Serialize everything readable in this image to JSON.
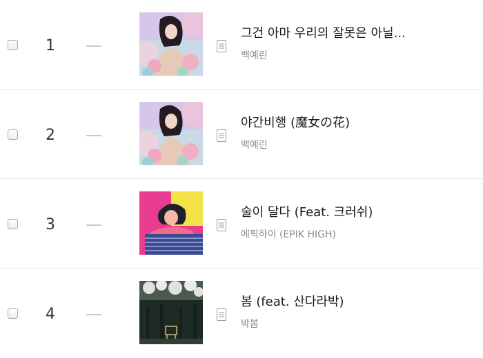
{
  "songs": [
    {
      "rank": "1",
      "title": "그건 아마 우리의 잘못은 아닐...",
      "artist": "백예린",
      "rank_change": "—"
    },
    {
      "rank": "2",
      "title": "야간비행 (魔女の花)",
      "artist": "백예린",
      "rank_change": "—"
    },
    {
      "rank": "3",
      "title": "술이 달다 (Feat. 크러쉬)",
      "artist": "에픽하이 (EPIK HIGH)",
      "rank_change": "—"
    },
    {
      "rank": "4",
      "title": "봄 (feat. 산다라박)",
      "artist": "박봄",
      "rank_change": "—"
    }
  ],
  "colors": {
    "divider": "#e6e6e6",
    "rank_change": "#c8c8c8",
    "title": "#1a1a1a",
    "artist": "#8a8a8a"
  },
  "icons": {
    "lyrics": "document-icon",
    "rank_change": "dash-icon"
  }
}
